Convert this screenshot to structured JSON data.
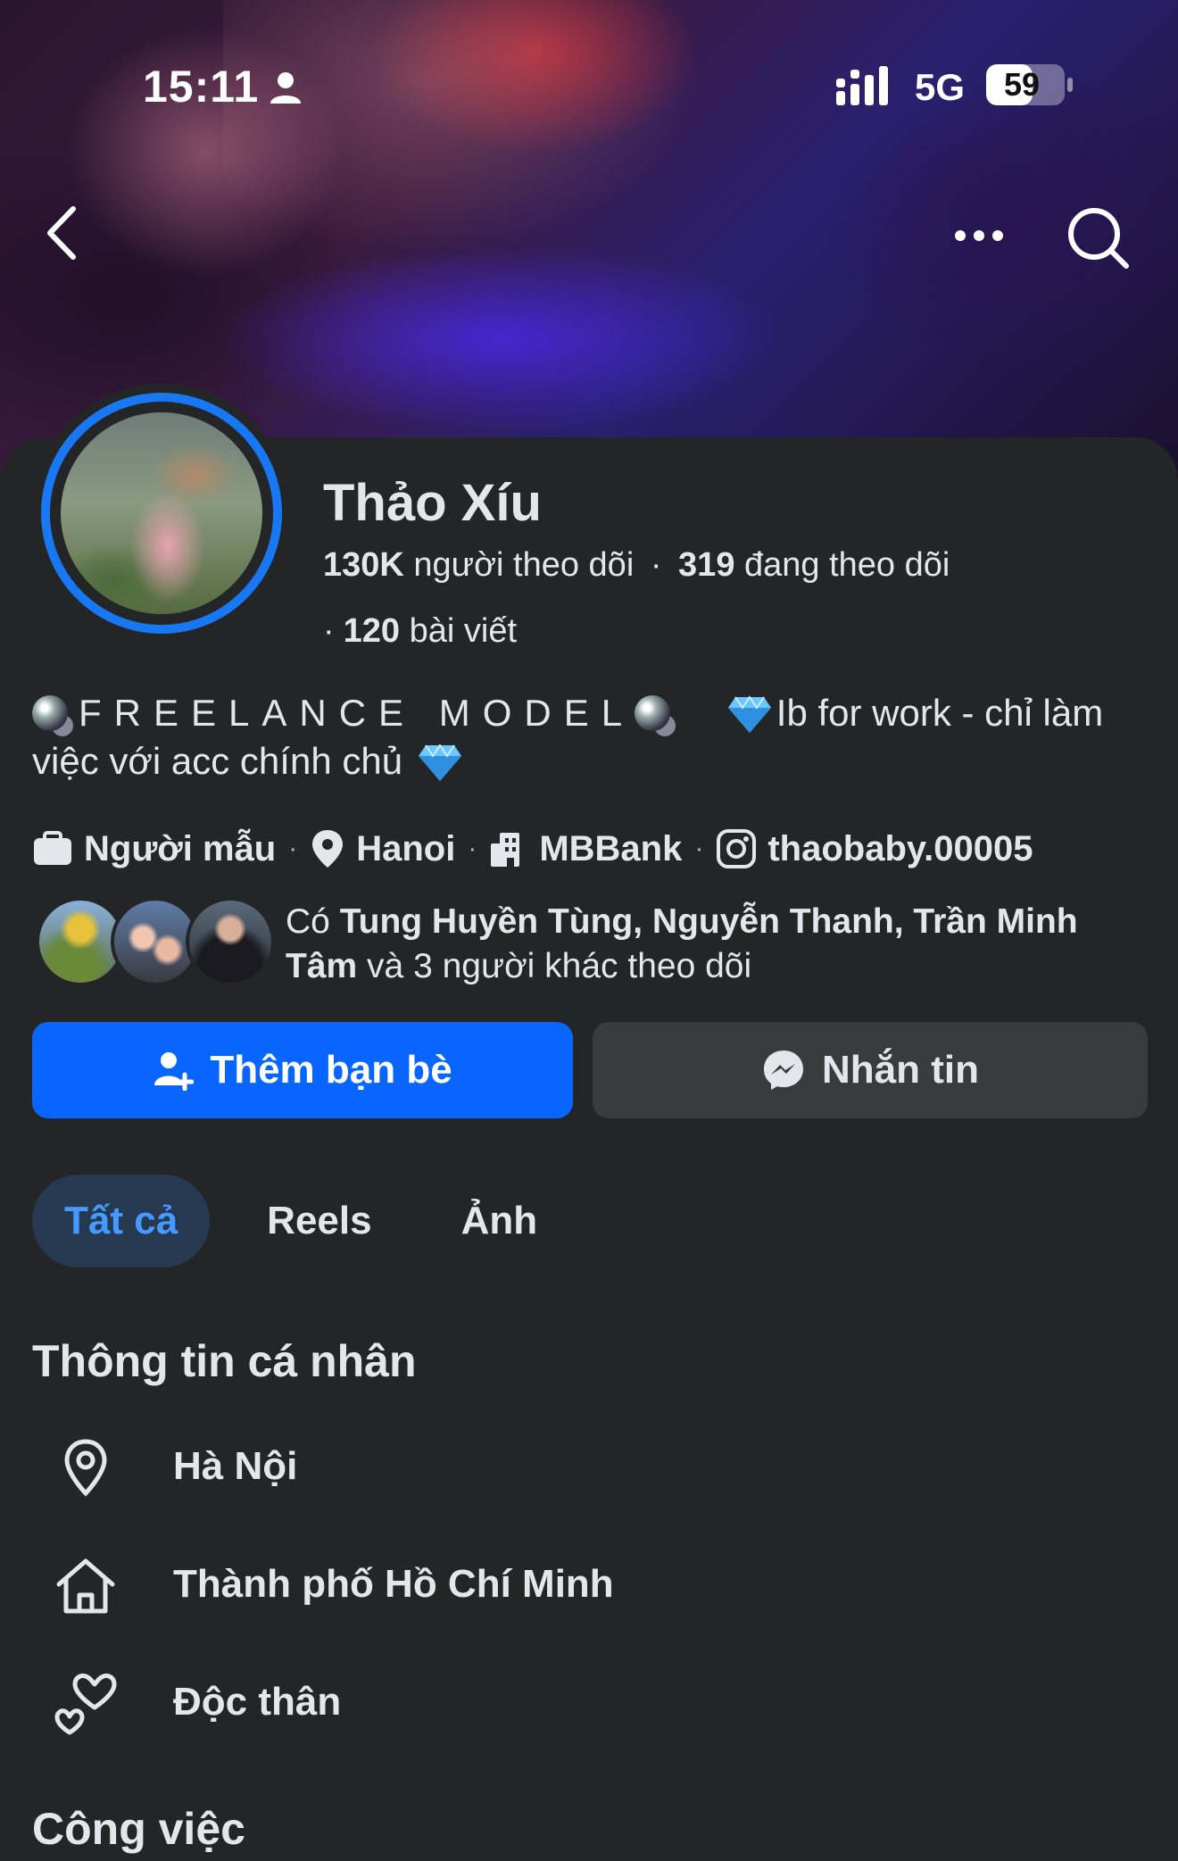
{
  "status_bar": {
    "time": "15:11",
    "network": "5G",
    "battery": "59",
    "battery_fraction": 0.59
  },
  "profile": {
    "name": "Thảo Xíu",
    "followers_count": "130K",
    "followers_label": "người theo dõi",
    "following_count": "319",
    "following_label": "đang theo dõi",
    "posts_count": "120",
    "posts_label": "bài viết"
  },
  "bio": {
    "headline": "FREELANCE MODEL",
    "text_1": "Ib for work - chỉ làm",
    "text_2": "việc với acc chính chủ"
  },
  "details": {
    "job": "Người mẫu",
    "city": "Hanoi",
    "company": "MBBank",
    "instagram": "thaobaby.00005"
  },
  "mutual": {
    "prefix": "Có",
    "names": "Tung Huyền Tùng, Nguyễn Thanh, Trần Minh Tâm",
    "suffix": "và 3 người khác theo dõi"
  },
  "actions": {
    "add_friend": "Thêm bạn bè",
    "message": "Nhắn tin"
  },
  "tabs": [
    {
      "label": "Tất cả",
      "active": true
    },
    {
      "label": "Reels",
      "active": false
    },
    {
      "label": "Ảnh",
      "active": false
    }
  ],
  "personal_info": {
    "title": "Thông tin cá nhân",
    "items": [
      {
        "icon": "location-pin-icon",
        "text": "Hà Nội"
      },
      {
        "icon": "home-icon",
        "text": "Thành phố Hồ Chí Minh"
      },
      {
        "icon": "hearts-icon",
        "text": "Độc thân"
      }
    ]
  },
  "work": {
    "title": "Công việc"
  },
  "colors": {
    "accent": "#0866ff",
    "ring": "#1877f2",
    "tab_active_bg": "#263951",
    "tab_active_text": "#4599ff",
    "background": "#242526"
  }
}
